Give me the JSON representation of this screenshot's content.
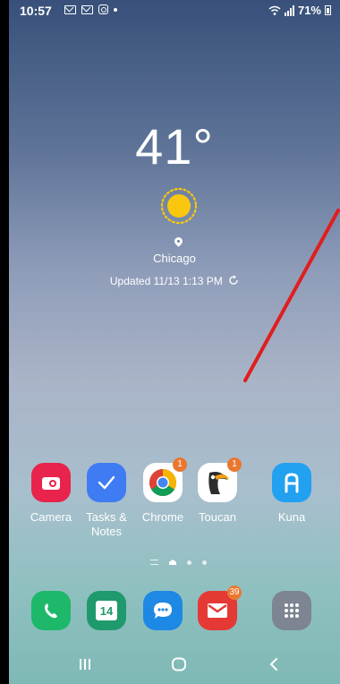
{
  "status_bar": {
    "time": "10:57",
    "battery_percent": "71%",
    "notification_icons": [
      "gmail-icon",
      "mail-icon",
      "instagram-icon",
      "more-dot-icon"
    ],
    "system_icons": [
      "wifi-icon",
      "signal-icon",
      "battery-icon"
    ]
  },
  "weather": {
    "temperature": "41°",
    "condition_icon": "sun-icon",
    "location": "Chicago",
    "updated": "Updated 11/13 1:13 PM"
  },
  "home_apps": [
    {
      "label": "Camera",
      "icon": "camera-icon",
      "color": "#e8244c"
    },
    {
      "label": "Tasks &\nNotes",
      "icon": "check-icon",
      "color": "#3f7cf3"
    },
    {
      "label": "Chrome",
      "icon": "chrome-icon",
      "color": "#ffffff",
      "badge": "1"
    },
    {
      "label": "Toucan",
      "icon": "toucan-icon",
      "color": "#ffffff",
      "badge": "1"
    },
    {
      "label": "Kuna",
      "icon": "kuna-icon",
      "color": "#21a1f0"
    }
  ],
  "pager": {
    "pages": 3,
    "current_page": 1
  },
  "dock_apps": [
    {
      "name": "phone",
      "icon": "phone-icon",
      "color": "#1db86a"
    },
    {
      "name": "calendar",
      "icon": "calendar-icon",
      "color": "#1f9a6c",
      "date": "14"
    },
    {
      "name": "messages",
      "icon": "message-icon",
      "color": "#1e88e5"
    },
    {
      "name": "email",
      "icon": "email-icon",
      "color": "#e53935",
      "badge": "39"
    },
    {
      "name": "apps",
      "icon": "app-grid-icon",
      "color": "#7c8591"
    }
  ],
  "navigation": {
    "recent": "recent-apps-icon",
    "home": "home-icon",
    "back": "back-icon"
  }
}
